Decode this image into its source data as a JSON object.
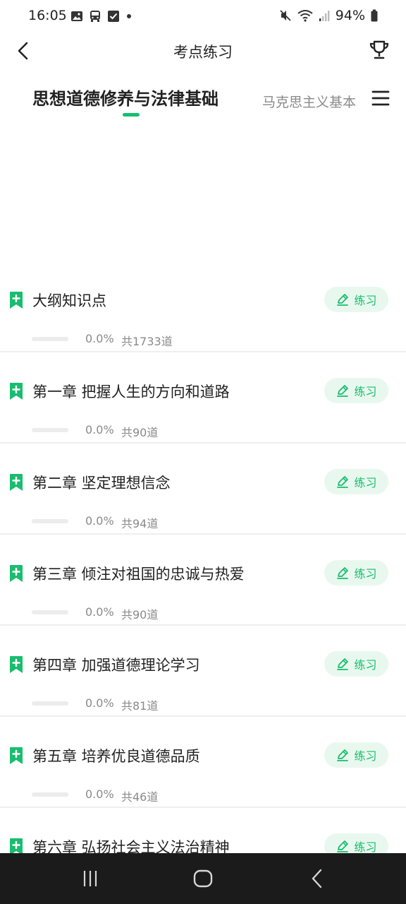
{
  "status_bar": {
    "time": "16:05",
    "battery": "94%"
  },
  "header": {
    "title": "考点练习"
  },
  "tabs": {
    "active": "思想道德修养与法律基础",
    "inactive": "马克思主义基本"
  },
  "chapters": [
    {
      "title": "大纲知识点",
      "progress": 0.0,
      "progress_text": "0.0%",
      "count": "共1733道",
      "button": "练习"
    },
    {
      "title": "第一章 把握人生的方向和道路",
      "progress": 0.0,
      "progress_text": "0.0%",
      "count": "共90道",
      "button": "练习"
    },
    {
      "title": "第二章 坚定理想信念",
      "progress": 0.0,
      "progress_text": "0.0%",
      "count": "共94道",
      "button": "练习"
    },
    {
      "title": "第三章 倾注对祖国的忠诚与热爱",
      "progress": 0.0,
      "progress_text": "0.0%",
      "count": "共90道",
      "button": "练习"
    },
    {
      "title": "第四章 加强道德理论学习",
      "progress": 0.0,
      "progress_text": "0.0%",
      "count": "共81道",
      "button": "练习"
    },
    {
      "title": "第五章 培养优良道德品质",
      "progress": 0.0,
      "progress_text": "0.0%",
      "count": "共46道",
      "button": "练习"
    },
    {
      "title": "第六章 弘扬社会主义法治精神",
      "button": "练习"
    }
  ],
  "colors": {
    "accent": "#19bd6f",
    "accent_bg": "#e9f8ef",
    "nav_bar": "#1b1b1b"
  },
  "icons": {
    "back": "chevron-left-icon",
    "trophy": "trophy-icon",
    "menu": "menu-icon",
    "bookmark": "bookmark-plus-icon",
    "practice": "pencil-icon"
  }
}
